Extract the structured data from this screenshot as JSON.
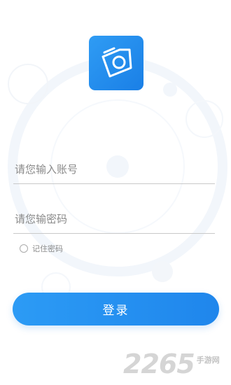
{
  "app": {
    "logo_icon": "camera-icon",
    "accent_color": "#1a84ea"
  },
  "form": {
    "account_placeholder": "请您输入账号",
    "password_placeholder": "请您输密码",
    "remember_label": "记住密码",
    "login_label": "登录"
  },
  "watermark": {
    "number": "2265",
    "site": "手游网"
  }
}
